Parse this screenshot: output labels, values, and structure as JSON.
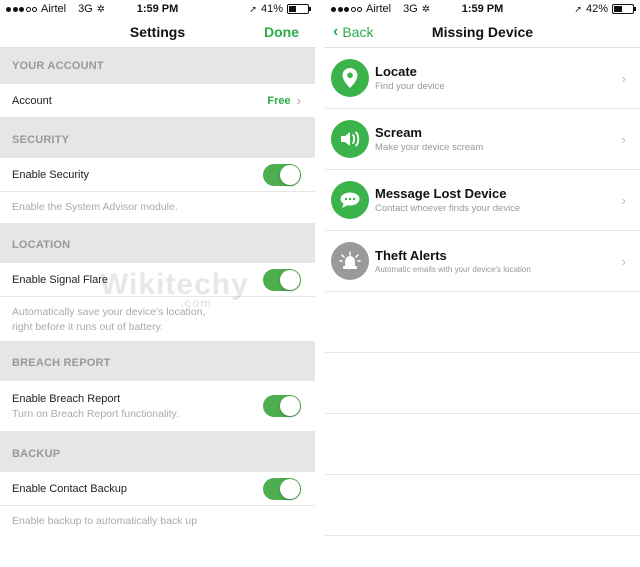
{
  "left": {
    "status": {
      "carrier": "Airtel",
      "network": "3G",
      "time": "1:59 PM",
      "battery": "41%",
      "battery_level": 0.41
    },
    "nav": {
      "title": "Settings",
      "done_label": "Done"
    },
    "sections": {
      "account": {
        "header": "YOUR ACCOUNT",
        "row_label": "Account",
        "row_value": "Free"
      },
      "security": {
        "header": "SECURITY",
        "row_label": "Enable Security",
        "desc": "Enable the System Advisor module."
      },
      "location": {
        "header": "LOCATION",
        "row_label": "Enable Signal Flare",
        "desc_line1": "Automatically save your device's location,",
        "desc_line2": "right before it runs out of battery."
      },
      "breach": {
        "header": "BREACH REPORT",
        "row_label": "Enable Breach Report",
        "row_sub": "Turn on Breach Report functionality."
      },
      "backup": {
        "header": "BACKUP",
        "row_label": "Enable Contact Backup",
        "desc": "Enable backup to automatically back up"
      }
    }
  },
  "right": {
    "status": {
      "carrier": "Airtel",
      "network": "3G",
      "time": "1:59 PM",
      "battery": "42%",
      "battery_level": 0.42
    },
    "nav": {
      "back_label": "Back",
      "title": "Missing Device"
    },
    "items": [
      {
        "title": "Locate",
        "subtitle": "Find your device",
        "icon": "location-pin-icon"
      },
      {
        "title": "Scream",
        "subtitle": "Make your device scream",
        "icon": "speaker-icon"
      },
      {
        "title": "Message Lost Device",
        "subtitle": "Contact whoever finds your device",
        "icon": "chat-bubble-icon"
      },
      {
        "title": "Theft Alerts",
        "subtitle": "Automatic emails with your device's location",
        "icon": "siren-icon"
      }
    ]
  },
  "watermark": {
    "text": "Wikitechy",
    "suffix": ".com"
  },
  "colors": {
    "accent": "#2daa4a",
    "toggle": "#4cae4f",
    "icon_green": "#3bb34b",
    "icon_grey": "#9a9a9a"
  }
}
